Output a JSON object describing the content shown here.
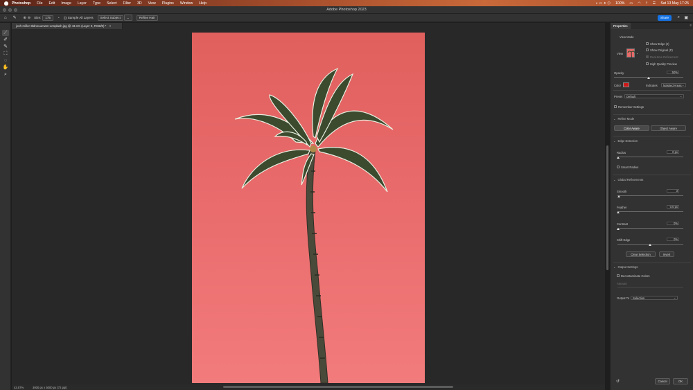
{
  "menubar": {
    "app": "Photoshop",
    "items": [
      "File",
      "Edit",
      "Image",
      "Layer",
      "Type",
      "Select",
      "Filter",
      "3D",
      "View",
      "Plugins",
      "Window",
      "Help"
    ],
    "battery": "100%",
    "clock": "Sat 13 May  17:25"
  },
  "window": {
    "title": "Adobe Photoshop 2023"
  },
  "options": {
    "size_label": "Size:",
    "size_value": "175",
    "sample_all_layers": "Sample All Layers",
    "select_subject": "Select Subject",
    "refine_hair": "Refine Hair",
    "share": "Share"
  },
  "document": {
    "tab": "josh-miller-8ldnnuumwm-unsplash.jpg @ 43.1% (Layer 0, RGB/8) *",
    "zoom": "43.07%",
    "dimensions": "3000 px x 5000 px (72 ppi)"
  },
  "panel": {
    "tab": "Properties",
    "view_mode": "View Mode",
    "view_label": "View",
    "show_edge": "Show Edge (J)",
    "show_original": "Show Original (P)",
    "realtime": "Real-time Refinement",
    "hq_preview": "High Quality Preview",
    "opacity_label": "Opacity",
    "opacity_value": "50%",
    "opacity_fraction": 0.5,
    "color_label": "Color",
    "color_value": "#d01818",
    "indicates_label": "Indicates",
    "indicates_value": "Masked Areas",
    "preset_label": "Preset",
    "preset_value": "Default",
    "remember": "Remember Settings",
    "refine_mode": "Refine Mode",
    "color_aware": "Color Aware",
    "object_aware": "Object Aware",
    "edge_detection": "Edge Detection",
    "radius_label": "Radius",
    "radius_value": "0 px",
    "smart_radius": "Smart Radius",
    "global": "Global Refinements",
    "smooth_label": "Smooth",
    "smooth_value": "3",
    "feather_label": "Feather",
    "feather_value": "0.0 px",
    "contrast_label": "Contrast",
    "contrast_value": "0%",
    "shift_label": "Shift Edge",
    "shift_value": "0%",
    "clear_selection": "Clear Selection",
    "invert": "Invert",
    "output_settings": "Output Settings",
    "decontaminate": "Decontaminate Colors",
    "amount_label": "Amount",
    "output_to_label": "Output To",
    "output_to_value": "Selection",
    "cancel": "Cancel",
    "ok": "OK"
  }
}
